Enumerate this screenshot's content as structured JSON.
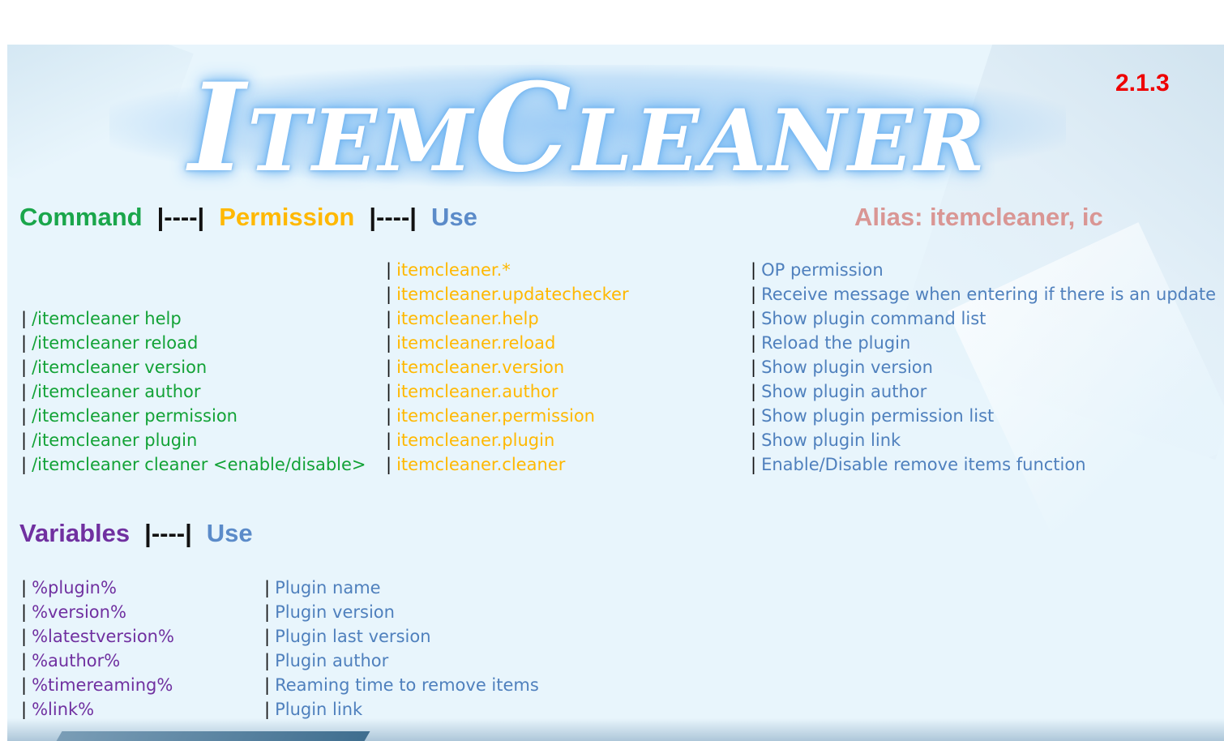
{
  "logo": {
    "text": "ItemCleaner"
  },
  "version": "2.1.3",
  "header": {
    "command": "Command",
    "sep1": "|----|",
    "permission": "Permission",
    "sep2": "|----|",
    "use": "Use",
    "alias": "Alias: itemcleaner, ic"
  },
  "commands": [
    {
      "command": "",
      "permission": "itemcleaner.*",
      "use": "OP permission"
    },
    {
      "command": "",
      "permission": "itemcleaner.updatechecker",
      "use": "Receive message when entering if there is an update"
    },
    {
      "command": "/itemcleaner help",
      "permission": "itemcleaner.help",
      "use": "Show plugin command list"
    },
    {
      "command": "/itemcleaner reload",
      "permission": "itemcleaner.reload",
      "use": "Reload the plugin"
    },
    {
      "command": "/itemcleaner version",
      "permission": "itemcleaner.version",
      "use": "Show plugin version"
    },
    {
      "command": "/itemcleaner author",
      "permission": "itemcleaner.author",
      "use": "Show plugin author"
    },
    {
      "command": "/itemcleaner permission",
      "permission": "itemcleaner.permission",
      "use": "Show plugin permission list"
    },
    {
      "command": "/itemcleaner plugin",
      "permission": "itemcleaner.plugin",
      "use": "Show plugin link"
    },
    {
      "command": "/itemcleaner cleaner <enable/disable>",
      "permission": "itemcleaner.cleaner",
      "use": "Enable/Disable remove items function"
    }
  ],
  "variables_header": {
    "title": "Variables",
    "sep": "|----|",
    "use": "Use"
  },
  "variables": [
    {
      "name": "%plugin%",
      "use": "Plugin name"
    },
    {
      "name": "%version%",
      "use": "Plugin version"
    },
    {
      "name": "%latestversion%",
      "use": "Plugin last version"
    },
    {
      "name": "%author%",
      "use": "Plugin author"
    },
    {
      "name": "%timereaming%",
      "use": "Reaming time to remove items"
    },
    {
      "name": "%link%",
      "use": "Plugin link"
    }
  ],
  "bar": "|",
  "colors": {
    "command": "#1aa64b",
    "permission": "#ffb800",
    "use": "#5b8bc9",
    "variables": "#7030a0",
    "alias": "#d99694",
    "version": "#ee0000",
    "background": "#e8f5fc"
  }
}
